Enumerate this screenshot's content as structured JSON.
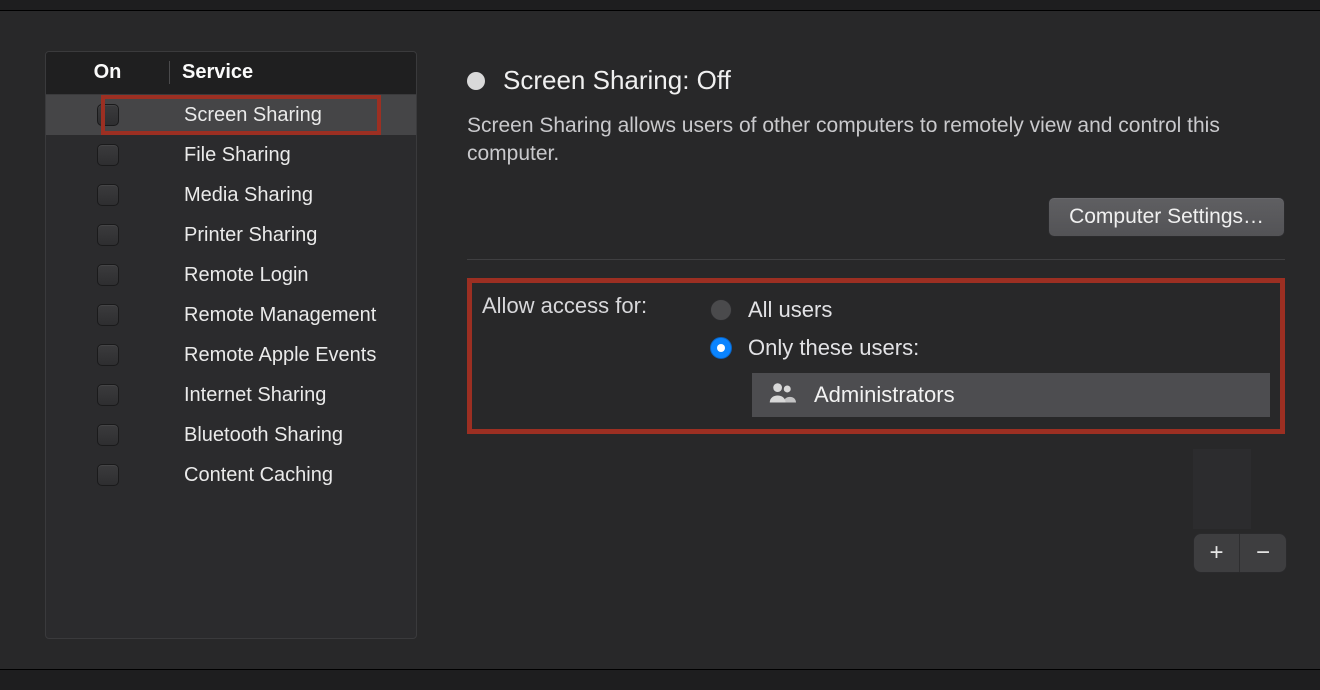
{
  "sidebar": {
    "header_on": "On",
    "header_service": "Service",
    "items": [
      {
        "label": "Screen Sharing",
        "checked": false,
        "selected": true
      },
      {
        "label": "File Sharing",
        "checked": false,
        "selected": false
      },
      {
        "label": "Media Sharing",
        "checked": false,
        "selected": false
      },
      {
        "label": "Printer Sharing",
        "checked": false,
        "selected": false
      },
      {
        "label": "Remote Login",
        "checked": false,
        "selected": false
      },
      {
        "label": "Remote Management",
        "checked": false,
        "selected": false
      },
      {
        "label": "Remote Apple Events",
        "checked": false,
        "selected": false
      },
      {
        "label": "Internet Sharing",
        "checked": false,
        "selected": false
      },
      {
        "label": "Bluetooth Sharing",
        "checked": false,
        "selected": false
      },
      {
        "label": "Content Caching",
        "checked": false,
        "selected": false
      }
    ]
  },
  "detail": {
    "status_title": "Screen Sharing: Off",
    "description": "Screen Sharing allows users of other computers to remotely view and control this computer.",
    "settings_button": "Computer Settings…",
    "access_label": "Allow access for:",
    "radio_all": "All users",
    "radio_only": "Only these users:",
    "users": [
      {
        "name": "Administrators"
      }
    ],
    "add_label": "+",
    "remove_label": "−"
  }
}
